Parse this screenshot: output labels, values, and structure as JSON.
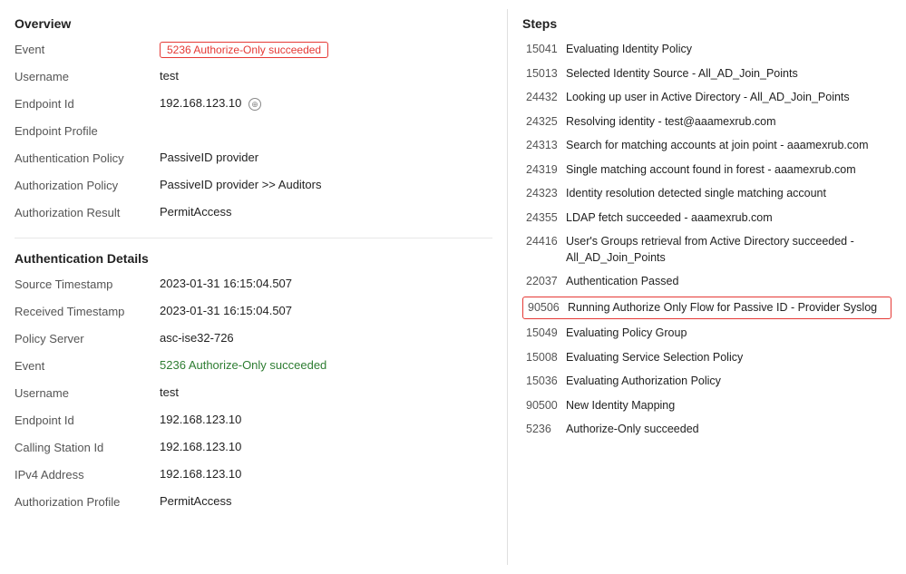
{
  "left": {
    "overview": {
      "title": "Overview",
      "fields": [
        {
          "label": "Event",
          "value": "5236 Authorize-Only succeeded",
          "type": "badge-red"
        },
        {
          "label": "Username",
          "value": "test"
        },
        {
          "label": "Endpoint Id",
          "value": "192.168.123.10",
          "hasIcon": true
        },
        {
          "label": "Endpoint Profile",
          "value": ""
        },
        {
          "label": "Authentication Policy",
          "value": "PassiveID provider"
        },
        {
          "label": "Authorization Policy",
          "value": "PassiveID provider >> Auditors"
        },
        {
          "label": "Authorization Result",
          "value": "PermitAccess"
        }
      ]
    },
    "authDetails": {
      "title": "Authentication Details",
      "fields": [
        {
          "label": "Source Timestamp",
          "value": "2023-01-31 16:15:04.507"
        },
        {
          "label": "Received Timestamp",
          "value": "2023-01-31 16:15:04.507"
        },
        {
          "label": "Policy Server",
          "value": "asc-ise32-726"
        },
        {
          "label": "Event",
          "value": "5236 Authorize-Only succeeded",
          "type": "badge-green"
        },
        {
          "label": "Username",
          "value": "test"
        },
        {
          "label": "Endpoint Id",
          "value": "192.168.123.10"
        },
        {
          "label": "Calling Station Id",
          "value": "192.168.123.10"
        },
        {
          "label": "IPv4 Address",
          "value": "192.168.123.10"
        },
        {
          "label": "Authorization Profile",
          "value": "PermitAccess"
        }
      ]
    }
  },
  "right": {
    "title": "Steps",
    "steps": [
      {
        "code": "15041",
        "desc": "Evaluating Identity Policy",
        "highlight": false
      },
      {
        "code": "15013",
        "desc": "Selected Identity Source - All_AD_Join_Points",
        "highlight": false
      },
      {
        "code": "24432",
        "desc": "Looking up user in Active Directory - All_AD_Join_Points",
        "highlight": false
      },
      {
        "code": "24325",
        "desc": "Resolving identity - test@aaamexrub.com",
        "highlight": false
      },
      {
        "code": "24313",
        "desc": "Search for matching accounts at join point - aaamexrub.com",
        "highlight": false
      },
      {
        "code": "24319",
        "desc": "Single matching account found in forest - aaamexrub.com",
        "highlight": false
      },
      {
        "code": "24323",
        "desc": "Identity resolution detected single matching account",
        "highlight": false
      },
      {
        "code": "24355",
        "desc": "LDAP fetch succeeded - aaamexrub.com",
        "highlight": false
      },
      {
        "code": "24416",
        "desc": "User's Groups retrieval from Active Directory succeeded - All_AD_Join_Points",
        "highlight": false
      },
      {
        "code": "22037",
        "desc": "Authentication Passed",
        "highlight": false
      },
      {
        "code": "90506",
        "desc": "Running Authorize Only Flow for Passive ID - Provider Syslog",
        "highlight": true
      },
      {
        "code": "15049",
        "desc": "Evaluating Policy Group",
        "highlight": false
      },
      {
        "code": "15008",
        "desc": "Evaluating Service Selection Policy",
        "highlight": false
      },
      {
        "code": "15036",
        "desc": "Evaluating Authorization Policy",
        "highlight": false
      },
      {
        "code": "90500",
        "desc": "New Identity Mapping",
        "highlight": false
      },
      {
        "code": "5236",
        "desc": "Authorize-Only succeeded",
        "highlight": false
      }
    ]
  }
}
